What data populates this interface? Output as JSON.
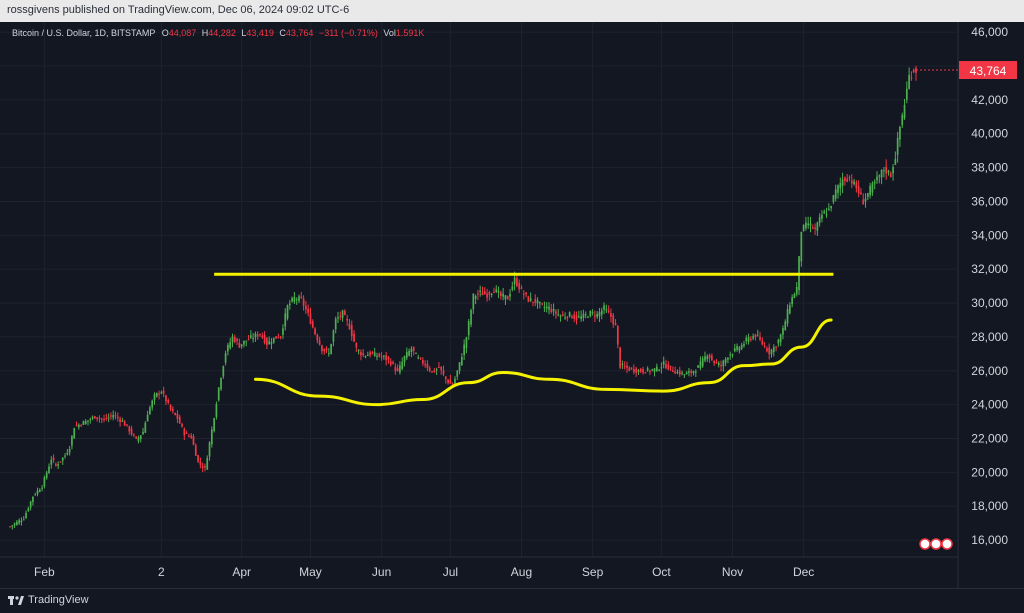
{
  "header": {
    "published": "rossgivens published on TradingView.com, Dec 06, 2024 09:02 UTC-6"
  },
  "legend": {
    "symbol": "Bitcoin / U.S. Dollar, 1D, BITSTAMP",
    "o_label": "O",
    "o_value": "44,087",
    "h_label": "H",
    "h_value": "44,282",
    "l_label": "L",
    "l_value": "43,419",
    "c_label": "C",
    "c_value": "43,764",
    "change": "−311 (−0.71%)",
    "vol_label": "Vol",
    "vol_value": "1.591K"
  },
  "footer": {
    "brand": "TradingView"
  },
  "colors": {
    "background": "#131722",
    "grid": "#1e222d",
    "up": "#4caf50",
    "down": "#f23645",
    "annotation": "#f5f200",
    "price_tag": "#f23645",
    "text": "#d1d4dc"
  },
  "chart_data": {
    "type": "candlestick",
    "title": "Bitcoin / U.S. Dollar, 1D, BITSTAMP",
    "ylim": [
      15000,
      46600
    ],
    "y_ticks": [
      "46,000",
      "44,000",
      "42,000",
      "40,000",
      "38,000",
      "36,000",
      "34,000",
      "32,000",
      "30,000",
      "28,000",
      "26,000",
      "24,000",
      "22,000",
      "20,000",
      "18,000",
      "16,000"
    ],
    "x_ticks": [
      "Feb",
      "2",
      "Apr",
      "May",
      "Jun",
      "Jul",
      "Aug",
      "Sep",
      "Oct",
      "Nov",
      "Dec"
    ],
    "last_price_label": "43,764",
    "last_price": 43764,
    "grid": true,
    "price_path": [
      [
        0,
        16800
      ],
      [
        6,
        17300
      ],
      [
        10,
        18600
      ],
      [
        14,
        19200
      ],
      [
        18,
        20800
      ],
      [
        20,
        20400
      ],
      [
        24,
        21000
      ],
      [
        26,
        21500
      ],
      [
        28,
        22700
      ],
      [
        33,
        23000
      ],
      [
        37,
        23300
      ],
      [
        41,
        23100
      ],
      [
        45,
        23400
      ],
      [
        49,
        23000
      ],
      [
        52,
        22500
      ],
      [
        55,
        21900
      ],
      [
        58,
        22400
      ],
      [
        60,
        23500
      ],
      [
        63,
        24500
      ],
      [
        66,
        24800
      ],
      [
        70,
        23700
      ],
      [
        73,
        23200
      ],
      [
        76,
        22300
      ],
      [
        79,
        22100
      ],
      [
        82,
        20600
      ],
      [
        85,
        20200
      ],
      [
        88,
        22500
      ],
      [
        91,
        25000
      ],
      [
        94,
        27100
      ],
      [
        97,
        28000
      ],
      [
        100,
        27500
      ],
      [
        103,
        27800
      ],
      [
        106,
        28000
      ],
      [
        109,
        28200
      ],
      [
        112,
        27600
      ],
      [
        115,
        27900
      ],
      [
        118,
        28100
      ],
      [
        121,
        29800
      ],
      [
        124,
        30300
      ],
      [
        127,
        30200
      ],
      [
        130,
        29300
      ],
      [
        133,
        28200
      ],
      [
        136,
        27300
      ],
      [
        139,
        27000
      ],
      [
        142,
        29000
      ],
      [
        145,
        29400
      ],
      [
        148,
        28600
      ],
      [
        151,
        27300
      ],
      [
        154,
        26900
      ],
      [
        157,
        27000
      ],
      [
        160,
        26900
      ],
      [
        163,
        26800
      ],
      [
        166,
        26500
      ],
      [
        169,
        25900
      ],
      [
        172,
        26800
      ],
      [
        175,
        27300
      ],
      [
        178,
        26700
      ],
      [
        181,
        26400
      ],
      [
        184,
        25900
      ],
      [
        187,
        26200
      ],
      [
        190,
        25500
      ],
      [
        193,
        25100
      ],
      [
        196,
        26400
      ],
      [
        199,
        28000
      ],
      [
        202,
        30400
      ],
      [
        205,
        30600
      ],
      [
        208,
        30500
      ],
      [
        211,
        30800
      ],
      [
        214,
        30400
      ],
      [
        217,
        30300
      ],
      [
        220,
        31400
      ],
      [
        223,
        30700
      ],
      [
        226,
        30200
      ],
      [
        229,
        30100
      ],
      [
        232,
        29800
      ],
      [
        235,
        29700
      ],
      [
        238,
        29400
      ],
      [
        241,
        29200
      ],
      [
        244,
        29300
      ],
      [
        247,
        29100
      ],
      [
        250,
        29200
      ],
      [
        253,
        29400
      ],
      [
        256,
        29300
      ],
      [
        259,
        29700
      ],
      [
        262,
        29200
      ],
      [
        264,
        28600
      ],
      [
        266,
        26300
      ],
      [
        270,
        26100
      ],
      [
        274,
        26000
      ],
      [
        278,
        26000
      ],
      [
        282,
        26100
      ],
      [
        285,
        26400
      ],
      [
        288,
        26100
      ],
      [
        291,
        25900
      ],
      [
        294,
        25800
      ],
      [
        297,
        25900
      ],
      [
        300,
        26200
      ],
      [
        304,
        27000
      ],
      [
        307,
        26500
      ],
      [
        310,
        26300
      ],
      [
        313,
        26900
      ],
      [
        316,
        27200
      ],
      [
        319,
        27500
      ],
      [
        322,
        27900
      ],
      [
        325,
        28100
      ],
      [
        328,
        27600
      ],
      [
        331,
        27100
      ],
      [
        334,
        27500
      ],
      [
        337,
        28400
      ],
      [
        340,
        30000
      ],
      [
        343,
        30900
      ],
      [
        345,
        34300
      ],
      [
        348,
        34700
      ],
      [
        351,
        34300
      ],
      [
        354,
        35200
      ],
      [
        357,
        35500
      ],
      [
        360,
        36600
      ],
      [
        363,
        37300
      ],
      [
        366,
        37400
      ],
      [
        369,
        36800
      ],
      [
        372,
        36000
      ],
      [
        375,
        36700
      ],
      [
        378,
        37300
      ],
      [
        381,
        37900
      ],
      [
        384,
        37600
      ],
      [
        386,
        38700
      ],
      [
        388,
        40400
      ],
      [
        390,
        41800
      ],
      [
        392,
        43400
      ],
      [
        394,
        43760
      ]
    ],
    "annotations": [
      {
        "type": "horizontal_line",
        "y": 31700,
        "x_from": "Mar",
        "x_to": "Nov"
      },
      {
        "type": "curve",
        "shape": "cup",
        "x_from": "Apr",
        "x_to": "Nov"
      }
    ]
  }
}
